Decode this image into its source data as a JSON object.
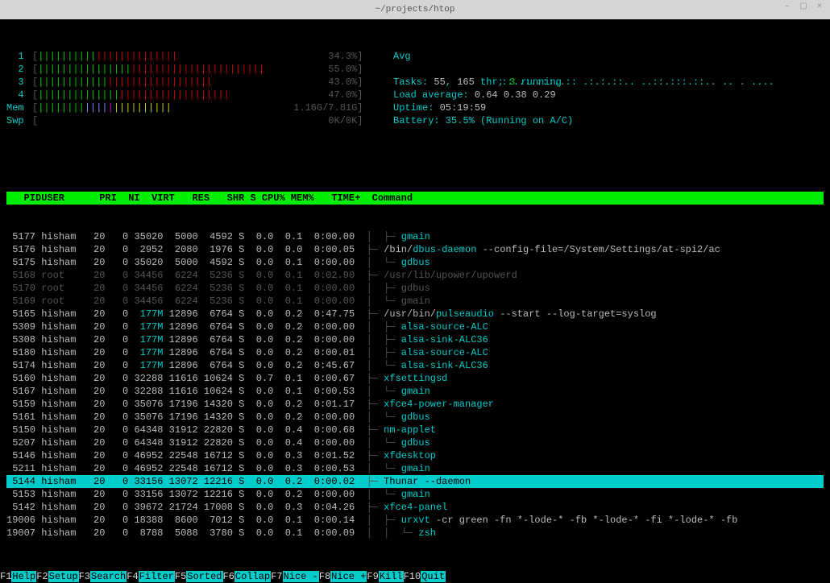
{
  "window_title": "~/projects/htop",
  "cpu_meters": [
    {
      "id": "1",
      "bars": "||||||||||||||||||||||||",
      "value": "34.3%"
    },
    {
      "id": "2",
      "bars": "|||||||||||||||||||||||||||||||||||||||",
      "value": "55.0%"
    },
    {
      "id": "3",
      "bars": "||||||||||||||||||||||||||||||",
      "value": "43.0%"
    },
    {
      "id": "4",
      "bars": "|||||||||||||||||||||||||||||||||",
      "value": "47.0%"
    }
  ],
  "mem": {
    "label": "Mem",
    "bars": "|||||||||||||||||||||||",
    "used": "1.16G",
    "total": "7.81G"
  },
  "swp": {
    "label": "Swp",
    "bars": "",
    "used": "0K",
    "total": "0K"
  },
  "avg_label": "Avg",
  "tasks": "Tasks: 55, 165 thr; 3 running",
  "load": "Load average: 0.64 0.38 0.29",
  "load_label": "Load average:",
  "load_vals": "0.64 0.38 0.29",
  "uptime": "Uptime: 05:19:59",
  "uptime_label": "Uptime:",
  "uptime_val": "05:19:59",
  "battery": "Battery: 35.5% (Running on A/C)",
  "columns": [
    "  PID",
    "USER     ",
    "PRI",
    " NI",
    " VIRT",
    "  RES",
    "  SHR",
    "S",
    "CPU%",
    "MEM%",
    "  TIME+ ",
    "Command"
  ],
  "rows": [
    {
      "pid": "5177",
      "user": "hisham",
      "pri": "20",
      "ni": "0",
      "virt": "35020",
      "res": "5000",
      "shr": "4592",
      "s": "S",
      "cpu": "0.0",
      "mem": "0.1",
      "time": "0:00.00",
      "tree": "│  ├─ ",
      "cmd": "gmain",
      "hl": "gmain"
    },
    {
      "pid": "5176",
      "user": "hisham",
      "pri": "20",
      "ni": "0",
      "virt": "2952",
      "res": "2080",
      "shr": "1976",
      "s": "S",
      "cpu": "0.0",
      "mem": "0.0",
      "time": "0:00.05",
      "tree": "├─ ",
      "cmd": "/bin/dbus-daemon --config-file=/System/Settings/at-spi2/ac",
      "hl": "dbus-daemon"
    },
    {
      "pid": "5175",
      "user": "hisham",
      "pri": "20",
      "ni": "0",
      "virt": "35020",
      "res": "5000",
      "shr": "4592",
      "s": "S",
      "cpu": "0.0",
      "mem": "0.1",
      "time": "0:00.00",
      "tree": "│  └─ ",
      "cmd": "gdbus",
      "hl": "gdbus"
    },
    {
      "pid": "5168",
      "user": "root",
      "pri": "20",
      "ni": "0",
      "virt": "34456",
      "res": "6224",
      "shr": "5236",
      "s": "S",
      "cpu": "0.0",
      "mem": "0.1",
      "time": "0:02.90",
      "tree": "├─ ",
      "cmd": "/usr/lib/upower/upowerd",
      "hl": "",
      "dim": true
    },
    {
      "pid": "5170",
      "user": "root",
      "pri": "20",
      "ni": "0",
      "virt": "34456",
      "res": "6224",
      "shr": "5236",
      "s": "S",
      "cpu": "0.0",
      "mem": "0.1",
      "time": "0:00.00",
      "tree": "│  ├─ ",
      "cmd": "gdbus",
      "hl": "",
      "dim": true
    },
    {
      "pid": "5169",
      "user": "root",
      "pri": "20",
      "ni": "0",
      "virt": "34456",
      "res": "6224",
      "shr": "5236",
      "s": "S",
      "cpu": "0.0",
      "mem": "0.1",
      "time": "0:00.00",
      "tree": "│  └─ ",
      "cmd": "gmain",
      "hl": "",
      "dim": true
    },
    {
      "pid": "5165",
      "user": "hisham",
      "pri": "20",
      "ni": "0",
      "virt": "177M",
      "res": "12896",
      "shr": "6764",
      "s": "S",
      "cpu": "0.0",
      "mem": "0.2",
      "time": "0:47.75",
      "tree": "├─ ",
      "cmd": "/usr/bin/pulseaudio --start --log-target=syslog",
      "hl": "pulseaudio"
    },
    {
      "pid": "5309",
      "user": "hisham",
      "pri": "20",
      "ni": "0",
      "virt": "177M",
      "res": "12896",
      "shr": "6764",
      "s": "S",
      "cpu": "0.0",
      "mem": "0.2",
      "time": "0:00.00",
      "tree": "│  ├─ ",
      "cmd": "alsa-source-ALC",
      "hl": "alsa-source-ALC"
    },
    {
      "pid": "5308",
      "user": "hisham",
      "pri": "20",
      "ni": "0",
      "virt": "177M",
      "res": "12896",
      "shr": "6764",
      "s": "S",
      "cpu": "0.0",
      "mem": "0.2",
      "time": "0:00.00",
      "tree": "│  ├─ ",
      "cmd": "alsa-sink-ALC36",
      "hl": "alsa-sink-ALC36"
    },
    {
      "pid": "5180",
      "user": "hisham",
      "pri": "20",
      "ni": "0",
      "virt": "177M",
      "res": "12896",
      "shr": "6764",
      "s": "S",
      "cpu": "0.0",
      "mem": "0.2",
      "time": "0:00.01",
      "tree": "│  ├─ ",
      "cmd": "alsa-source-ALC",
      "hl": "alsa-source-ALC"
    },
    {
      "pid": "5174",
      "user": "hisham",
      "pri": "20",
      "ni": "0",
      "virt": "177M",
      "res": "12896",
      "shr": "6764",
      "s": "S",
      "cpu": "0.0",
      "mem": "0.2",
      "time": "0:45.67",
      "tree": "│  └─ ",
      "cmd": "alsa-sink-ALC36",
      "hl": "alsa-sink-ALC36"
    },
    {
      "pid": "5160",
      "user": "hisham",
      "pri": "20",
      "ni": "0",
      "virt": "32288",
      "res": "11616",
      "shr": "10624",
      "s": "S",
      "cpu": "0.7",
      "mem": "0.1",
      "time": "0:00.67",
      "tree": "├─ ",
      "cmd": "xfsettingsd",
      "hl": "xfsettingsd"
    },
    {
      "pid": "5167",
      "user": "hisham",
      "pri": "20",
      "ni": "0",
      "virt": "32288",
      "res": "11616",
      "shr": "10624",
      "s": "S",
      "cpu": "0.0",
      "mem": "0.1",
      "time": "0:00.53",
      "tree": "│  └─ ",
      "cmd": "gmain",
      "hl": "gmain"
    },
    {
      "pid": "5159",
      "user": "hisham",
      "pri": "20",
      "ni": "0",
      "virt": "35076",
      "res": "17196",
      "shr": "14320",
      "s": "S",
      "cpu": "0.0",
      "mem": "0.2",
      "time": "0:01.17",
      "tree": "├─ ",
      "cmd": "xfce4-power-manager",
      "hl": "xfce4-power-manager"
    },
    {
      "pid": "5161",
      "user": "hisham",
      "pri": "20",
      "ni": "0",
      "virt": "35076",
      "res": "17196",
      "shr": "14320",
      "s": "S",
      "cpu": "0.0",
      "mem": "0.2",
      "time": "0:00.00",
      "tree": "│  └─ ",
      "cmd": "gdbus",
      "hl": "gdbus"
    },
    {
      "pid": "5150",
      "user": "hisham",
      "pri": "20",
      "ni": "0",
      "virt": "64348",
      "res": "31912",
      "shr": "22820",
      "s": "S",
      "cpu": "0.0",
      "mem": "0.4",
      "time": "0:00.68",
      "tree": "├─ ",
      "cmd": "nm-applet",
      "hl": "nm-applet"
    },
    {
      "pid": "5207",
      "user": "hisham",
      "pri": "20",
      "ni": "0",
      "virt": "64348",
      "res": "31912",
      "shr": "22820",
      "s": "S",
      "cpu": "0.0",
      "mem": "0.4",
      "time": "0:00.00",
      "tree": "│  └─ ",
      "cmd": "gdbus",
      "hl": "gdbus"
    },
    {
      "pid": "5146",
      "user": "hisham",
      "pri": "20",
      "ni": "0",
      "virt": "46952",
      "res": "22548",
      "shr": "16712",
      "s": "S",
      "cpu": "0.0",
      "mem": "0.3",
      "time": "0:01.52",
      "tree": "├─ ",
      "cmd": "xfdesktop",
      "hl": "xfdesktop"
    },
    {
      "pid": "5211",
      "user": "hisham",
      "pri": "20",
      "ni": "0",
      "virt": "46952",
      "res": "22548",
      "shr": "16712",
      "s": "S",
      "cpu": "0.0",
      "mem": "0.3",
      "time": "0:00.53",
      "tree": "│  └─ ",
      "cmd": "gmain",
      "hl": "gmain"
    },
    {
      "pid": "5144",
      "user": "hisham",
      "pri": "20",
      "ni": "0",
      "virt": "33156",
      "res": "13072",
      "shr": "12216",
      "s": "S",
      "cpu": "0.0",
      "mem": "0.2",
      "time": "0:00.02",
      "tree": "├─ ",
      "cmd": "Thunar --daemon",
      "hl": "Thunar",
      "sel": true
    },
    {
      "pid": "5153",
      "user": "hisham",
      "pri": "20",
      "ni": "0",
      "virt": "33156",
      "res": "13072",
      "shr": "12216",
      "s": "S",
      "cpu": "0.0",
      "mem": "0.2",
      "time": "0:00.00",
      "tree": "│  └─ ",
      "cmd": "gmain",
      "hl": "gmain"
    },
    {
      "pid": "5142",
      "user": "hisham",
      "pri": "20",
      "ni": "0",
      "virt": "39672",
      "res": "21724",
      "shr": "17008",
      "s": "S",
      "cpu": "0.0",
      "mem": "0.3",
      "time": "0:04.26",
      "tree": "├─ ",
      "cmd": "xfce4-panel",
      "hl": "xfce4-panel"
    },
    {
      "pid": "19006",
      "user": "hisham",
      "pri": "20",
      "ni": "0",
      "virt": "18388",
      "res": "8600",
      "shr": "7012",
      "s": "S",
      "cpu": "0.0",
      "mem": "0.1",
      "time": "0:00.14",
      "tree": "│  ├─ ",
      "cmd": "urxvt -cr green -fn *-lode-* -fb *-lode-* -fi *-lode-* -fb",
      "hl": "urxvt"
    },
    {
      "pid": "19007",
      "user": "hisham",
      "pri": "20",
      "ni": "0",
      "virt": "8788",
      "res": "5088",
      "shr": "3780",
      "s": "S",
      "cpu": "0.0",
      "mem": "0.1",
      "time": "0:00.09",
      "tree": "│  │  └─ ",
      "cmd": "zsh",
      "hl": "zsh"
    }
  ],
  "fkeys": [
    {
      "f": "F1",
      "a": "Help"
    },
    {
      "f": "F2",
      "a": "Setup"
    },
    {
      "f": "F3",
      "a": "Search"
    },
    {
      "f": "F4",
      "a": "Filter"
    },
    {
      "f": "F5",
      "a": "Sorted"
    },
    {
      "f": "F6",
      "a": "Collap"
    },
    {
      "f": "F7",
      "a": "Nice -"
    },
    {
      "f": "F8",
      "a": "Nice +"
    },
    {
      "f": "F9",
      "a": "Kill  "
    },
    {
      "f": "F10",
      "a": "Quit  "
    }
  ]
}
